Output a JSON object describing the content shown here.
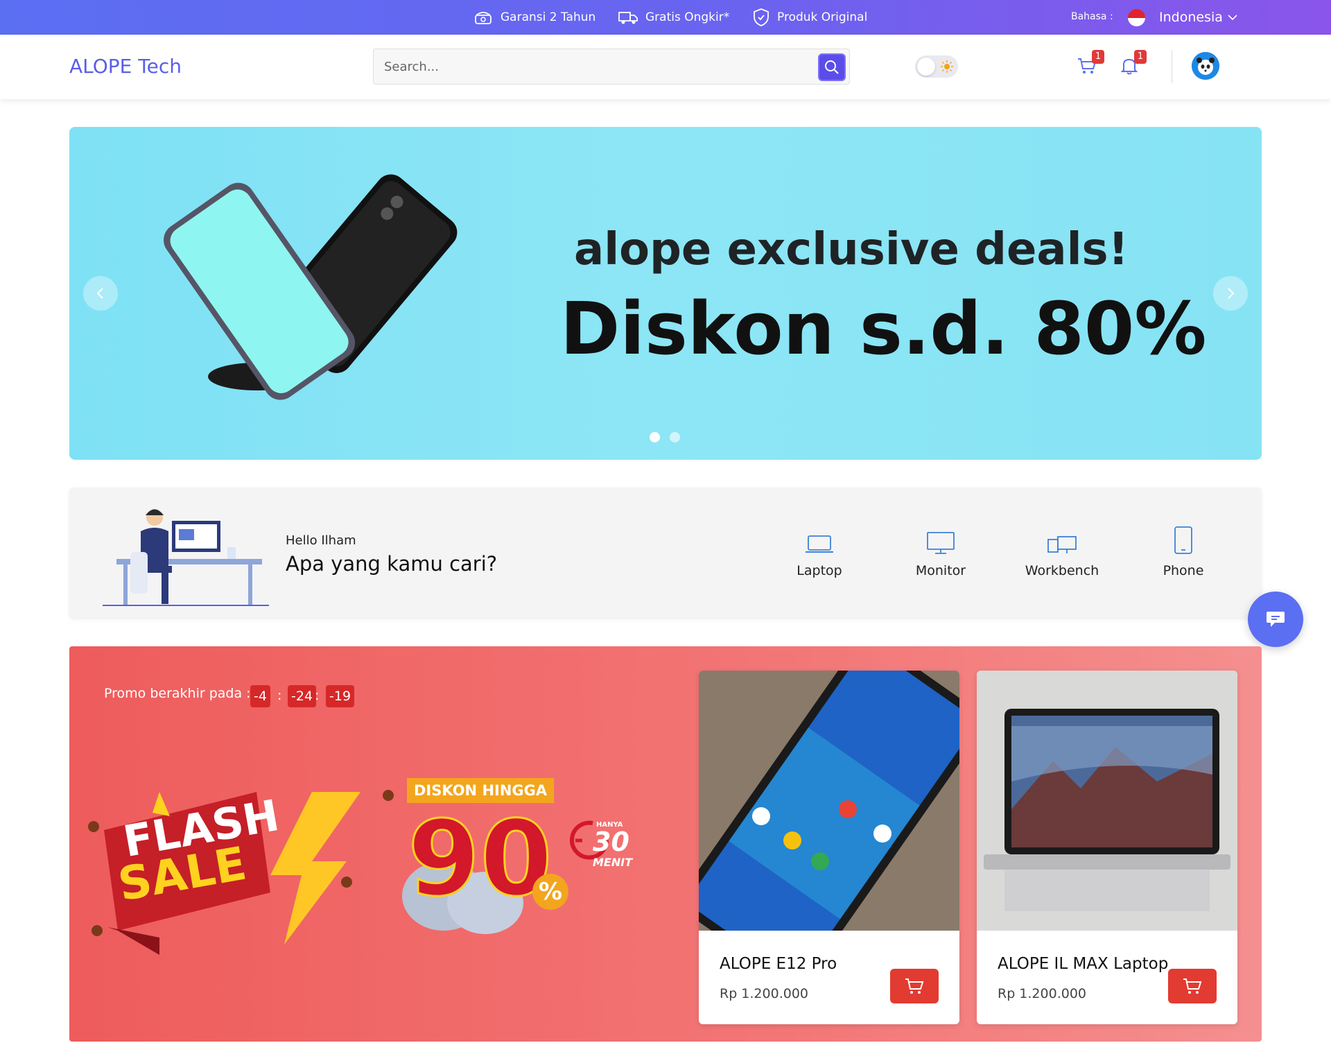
{
  "topbar": {
    "features": [
      {
        "label": "Garansi 2 Tahun",
        "icon": "warranty-icon"
      },
      {
        "label": "Gratis Ongkir*",
        "icon": "truck-icon"
      },
      {
        "label": "Produk Original",
        "icon": "shield-icon"
      }
    ],
    "language_label": "Bahasa :",
    "language_value": "Indonesia"
  },
  "header": {
    "brand": "ALOPE Tech",
    "search_placeholder": "Search...",
    "cart_badge": "1",
    "notification_badge": "1"
  },
  "banner": {
    "line1": "alope exclusive deals!",
    "line2": "Diskon s.d. 80%",
    "slides": 2,
    "active_slide": 1
  },
  "categories_section": {
    "greeting": "Hello Ilham",
    "question": "Apa yang kamu cari?",
    "items": [
      {
        "label": "Laptop",
        "icon": "laptop-icon"
      },
      {
        "label": "Monitor",
        "icon": "monitor-icon"
      },
      {
        "label": "Workbench",
        "icon": "workbench-icon"
      },
      {
        "label": "Phone",
        "icon": "phone-icon"
      }
    ]
  },
  "flash_sale": {
    "promo_label": "Promo berakhir pada :",
    "countdown": [
      "-4",
      "-24",
      "-19"
    ],
    "badge_title_1": "FLASH",
    "badge_title_2": "SALE",
    "discount_label": "DISKON HINGGA",
    "discount_value": "90",
    "discount_unit": "%",
    "timer_top": "HANYA",
    "timer_value": "30",
    "timer_unit": "MENIT",
    "products": [
      {
        "name": "ALOPE E12 Pro",
        "price": "Rp 1.200.000"
      },
      {
        "name": "ALOPE IL MAX Laptop",
        "price": "Rp 1.200.000"
      }
    ]
  },
  "colors": {
    "topbar_start": "#5b6ff3",
    "topbar_end": "#8a55ea",
    "brand": "#5a5ee8",
    "banner_bg": "#86e3f4",
    "flash_bg": "#ee5c5c",
    "cart_button": "#e23b32"
  }
}
